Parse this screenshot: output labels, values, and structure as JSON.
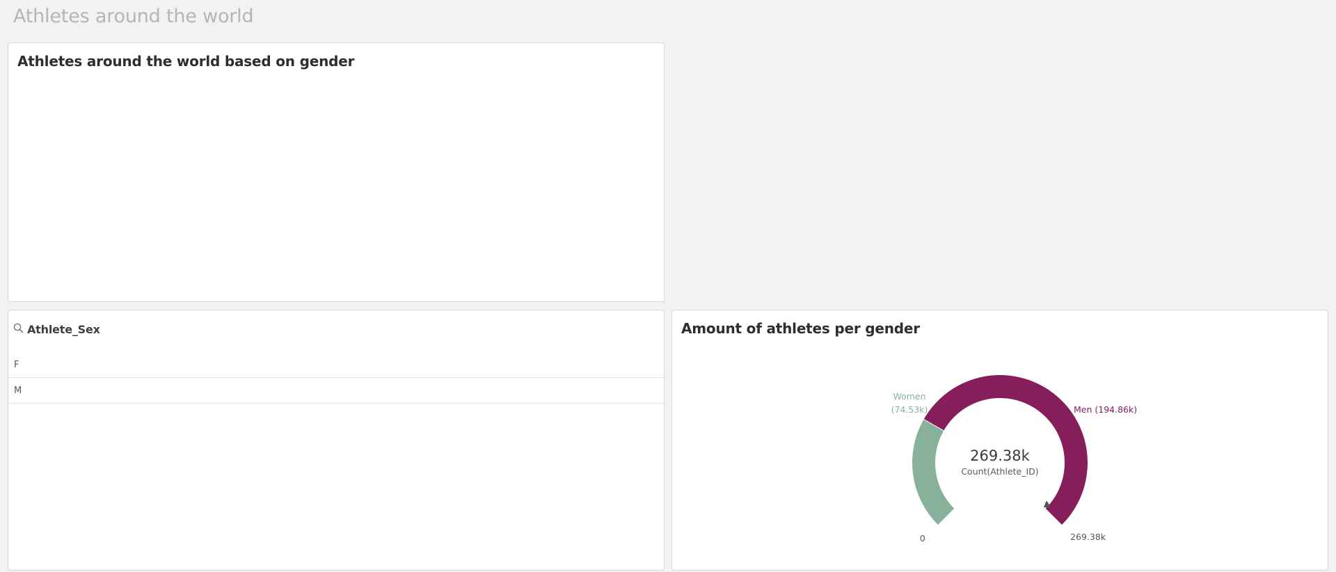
{
  "sheet": {
    "title": "Athletes around the world"
  },
  "map_panel": {
    "title": "Athletes around the world based on gender"
  },
  "filter_panel": {
    "title": "Athlete_Sex",
    "icon": "search-icon",
    "values": [
      "F",
      "M"
    ]
  },
  "gauge_panel": {
    "title": "Amount of athletes per gender",
    "center_value": "269.38k",
    "center_label": "Count(Athlete_ID)",
    "min_label": "0",
    "max_label": "269.38k",
    "colors": {
      "women": "#88b19c",
      "men": "#861e5b"
    }
  },
  "chart_data": {
    "type": "gauge",
    "title": "Amount of athletes per gender",
    "measure": "Count(Athlete_ID)",
    "total": 269380,
    "range": [
      0,
      269380
    ],
    "segments": [
      {
        "name": "Women",
        "value": 74530,
        "label_line1": "Women",
        "label_line2": "(74.53k)"
      },
      {
        "name": "Men",
        "value": 194860,
        "label_line1": "Men (194.86k)",
        "label_line2": ""
      }
    ]
  }
}
